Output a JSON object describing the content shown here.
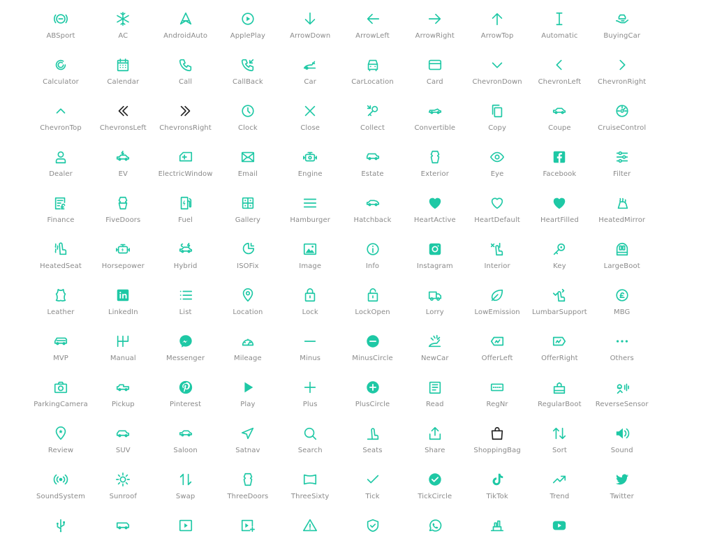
{
  "colors": {
    "icon": "#1ec8a5",
    "icon_alt": "#222222",
    "label": "#8a8a8a",
    "background": "#ffffff"
  },
  "icons": [
    {
      "label": "ABSport",
      "icon": "abs-sport-icon"
    },
    {
      "label": "AC",
      "icon": "snowflake-icon"
    },
    {
      "label": "AndroidAuto",
      "icon": "android-auto-icon"
    },
    {
      "label": "ApplePlay",
      "icon": "apple-play-icon"
    },
    {
      "label": "ArrowDown",
      "icon": "arrow-down-icon"
    },
    {
      "label": "ArrowLeft",
      "icon": "arrow-left-icon"
    },
    {
      "label": "ArrowRight",
      "icon": "arrow-right-icon"
    },
    {
      "label": "ArrowTop",
      "icon": "arrow-up-icon"
    },
    {
      "label": "Automatic",
      "icon": "automatic-icon"
    },
    {
      "label": "BuyingCar",
      "icon": "buying-car-icon"
    },
    {
      "label": "Calculator",
      "icon": "calculator-icon"
    },
    {
      "label": "Calendar",
      "icon": "calendar-icon"
    },
    {
      "label": "Call",
      "icon": "phone-icon"
    },
    {
      "label": "CallBack",
      "icon": "callback-icon"
    },
    {
      "label": "Car",
      "icon": "car-icon"
    },
    {
      "label": "CarLocation",
      "icon": "car-location-icon"
    },
    {
      "label": "Card",
      "icon": "card-icon"
    },
    {
      "label": "ChevronDown",
      "icon": "chevron-down-icon"
    },
    {
      "label": "ChevronLeft",
      "icon": "chevron-left-icon"
    },
    {
      "label": "ChevronRight",
      "icon": "chevron-right-icon"
    },
    {
      "label": "ChevronTop",
      "icon": "chevron-up-icon"
    },
    {
      "label": "ChevronsLeft",
      "icon": "chevrons-left-icon"
    },
    {
      "label": "ChevronsRight",
      "icon": "chevrons-right-icon"
    },
    {
      "label": "Clock",
      "icon": "clock-icon"
    },
    {
      "label": "Close",
      "icon": "close-icon"
    },
    {
      "label": "Collect",
      "icon": "collect-icon"
    },
    {
      "label": "Convertible",
      "icon": "convertible-icon"
    },
    {
      "label": "Copy",
      "icon": "copy-icon"
    },
    {
      "label": "Coupe",
      "icon": "coupe-icon"
    },
    {
      "label": "CruiseControl",
      "icon": "cruise-control-icon"
    },
    {
      "label": "Dealer",
      "icon": "dealer-icon"
    },
    {
      "label": "EV",
      "icon": "ev-icon"
    },
    {
      "label": "ElectricWindow",
      "icon": "electric-window-icon"
    },
    {
      "label": "Email",
      "icon": "email-icon"
    },
    {
      "label": "Engine",
      "icon": "engine-icon"
    },
    {
      "label": "Estate",
      "icon": "estate-icon"
    },
    {
      "label": "Exterior",
      "icon": "exterior-icon"
    },
    {
      "label": "Eye",
      "icon": "eye-icon"
    },
    {
      "label": "Facebook",
      "icon": "facebook-icon"
    },
    {
      "label": "Filter",
      "icon": "filter-icon"
    },
    {
      "label": "Finance",
      "icon": "finance-icon"
    },
    {
      "label": "FiveDoors",
      "icon": "five-doors-icon"
    },
    {
      "label": "Fuel",
      "icon": "fuel-icon"
    },
    {
      "label": "Gallery",
      "icon": "gallery-icon"
    },
    {
      "label": "Hamburger",
      "icon": "hamburger-icon"
    },
    {
      "label": "Hatchback",
      "icon": "hatchback-icon"
    },
    {
      "label": "HeartActive",
      "icon": "heart-active-icon"
    },
    {
      "label": "HeartDefault",
      "icon": "heart-default-icon"
    },
    {
      "label": "HeartFilled",
      "icon": "heart-filled-icon"
    },
    {
      "label": "HeatedMirror",
      "icon": "heated-mirror-icon"
    },
    {
      "label": "HeatedSeat",
      "icon": "heated-seat-icon"
    },
    {
      "label": "Horsepower",
      "icon": "horsepower-icon"
    },
    {
      "label": "Hybrid",
      "icon": "hybrid-icon"
    },
    {
      "label": "ISOFix",
      "icon": "isofix-icon"
    },
    {
      "label": "Image",
      "icon": "image-icon"
    },
    {
      "label": "Info",
      "icon": "info-icon"
    },
    {
      "label": "Instagram",
      "icon": "instagram-icon"
    },
    {
      "label": "Interior",
      "icon": "interior-icon"
    },
    {
      "label": "Key",
      "icon": "key-icon"
    },
    {
      "label": "LargeBoot",
      "icon": "large-boot-icon"
    },
    {
      "label": "Leather",
      "icon": "leather-icon"
    },
    {
      "label": "LinkedIn",
      "icon": "linkedin-icon"
    },
    {
      "label": "List",
      "icon": "list-icon"
    },
    {
      "label": "Location",
      "icon": "location-icon"
    },
    {
      "label": "Lock",
      "icon": "lock-icon"
    },
    {
      "label": "LockOpen",
      "icon": "lock-open-icon"
    },
    {
      "label": "Lorry",
      "icon": "lorry-icon"
    },
    {
      "label": "LowEmission",
      "icon": "low-emission-icon"
    },
    {
      "label": "LumbarSupport",
      "icon": "lumbar-support-icon"
    },
    {
      "label": "MBG",
      "icon": "mbg-icon"
    },
    {
      "label": "MVP",
      "icon": "mvp-icon"
    },
    {
      "label": "Manual",
      "icon": "manual-icon"
    },
    {
      "label": "Messenger",
      "icon": "messenger-icon"
    },
    {
      "label": "Mileage",
      "icon": "mileage-icon"
    },
    {
      "label": "Minus",
      "icon": "minus-icon"
    },
    {
      "label": "MinusCircle",
      "icon": "minus-circle-icon"
    },
    {
      "label": "NewCar",
      "icon": "new-car-icon"
    },
    {
      "label": "OfferLeft",
      "icon": "offer-left-icon"
    },
    {
      "label": "OfferRight",
      "icon": "offer-right-icon"
    },
    {
      "label": "Others",
      "icon": "more-dots-icon"
    },
    {
      "label": "ParkingCamera",
      "icon": "parking-camera-icon"
    },
    {
      "label": "Pickup",
      "icon": "pickup-icon"
    },
    {
      "label": "Pinterest",
      "icon": "pinterest-icon"
    },
    {
      "label": "Play",
      "icon": "play-icon"
    },
    {
      "label": "Plus",
      "icon": "plus-icon"
    },
    {
      "label": "PlusCircle",
      "icon": "plus-circle-icon"
    },
    {
      "label": "Read",
      "icon": "read-icon"
    },
    {
      "label": "RegNr",
      "icon": "reg-nr-icon"
    },
    {
      "label": "RegularBoot",
      "icon": "regular-boot-icon"
    },
    {
      "label": "ReverseSensor",
      "icon": "reverse-sensor-icon"
    },
    {
      "label": "Review",
      "icon": "review-icon"
    },
    {
      "label": "SUV",
      "icon": "suv-icon"
    },
    {
      "label": "Saloon",
      "icon": "saloon-icon"
    },
    {
      "label": "Satnav",
      "icon": "satnav-icon"
    },
    {
      "label": "Search",
      "icon": "search-icon"
    },
    {
      "label": "Seats",
      "icon": "seats-icon"
    },
    {
      "label": "Share",
      "icon": "share-icon"
    },
    {
      "label": "ShoppingBag",
      "icon": "shopping-bag-icon"
    },
    {
      "label": "Sort",
      "icon": "sort-icon"
    },
    {
      "label": "Sound",
      "icon": "sound-icon"
    },
    {
      "label": "SoundSystem",
      "icon": "sound-system-icon"
    },
    {
      "label": "Sunroof",
      "icon": "sunroof-icon"
    },
    {
      "label": "Swap",
      "icon": "swap-icon"
    },
    {
      "label": "ThreeDoors",
      "icon": "three-doors-icon"
    },
    {
      "label": "ThreeSixty",
      "icon": "three-sixty-icon"
    },
    {
      "label": "Tick",
      "icon": "tick-icon"
    },
    {
      "label": "TickCircle",
      "icon": "tick-circle-icon"
    },
    {
      "label": "TikTok",
      "icon": "tiktok-icon"
    },
    {
      "label": "Trend",
      "icon": "trend-icon"
    },
    {
      "label": "Twitter",
      "icon": "twitter-icon"
    },
    {
      "label": "",
      "icon": "usb-icon"
    },
    {
      "label": "",
      "icon": "van-icon"
    },
    {
      "label": "",
      "icon": "video-icon"
    },
    {
      "label": "",
      "icon": "video-add-icon"
    },
    {
      "label": "",
      "icon": "warning-icon"
    },
    {
      "label": "",
      "icon": "warranty-shield-icon"
    },
    {
      "label": "",
      "icon": "whatsapp-icon"
    },
    {
      "label": "",
      "icon": "wheelchair-icon"
    },
    {
      "label": "",
      "icon": "youtube-icon"
    }
  ]
}
